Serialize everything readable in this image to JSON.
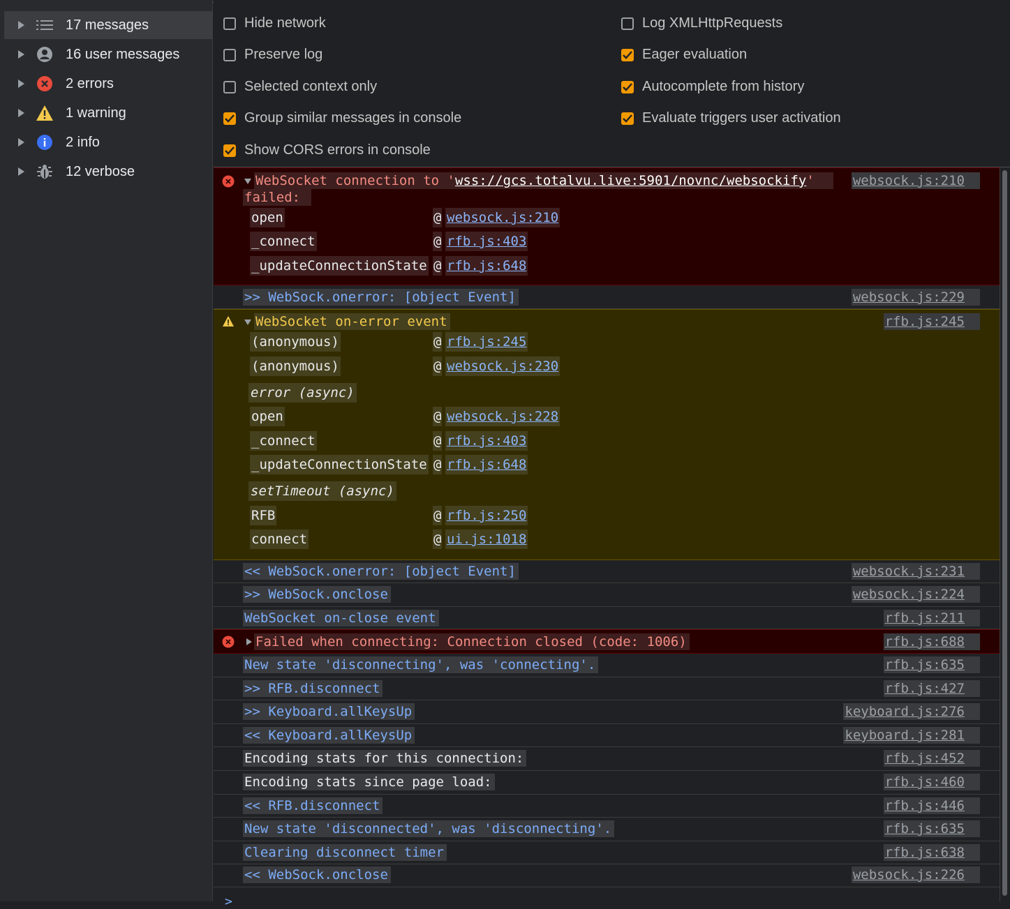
{
  "sidebar": {
    "items": [
      {
        "label": "17 messages",
        "icon": "list-icon"
      },
      {
        "label": "16 user messages",
        "icon": "user-icon"
      },
      {
        "label": "2 errors",
        "icon": "error-icon"
      },
      {
        "label": "1 warning",
        "icon": "warning-icon"
      },
      {
        "label": "2 info",
        "icon": "info-icon"
      },
      {
        "label": "12 verbose",
        "icon": "bug-icon"
      }
    ]
  },
  "settings": {
    "left": [
      {
        "label": "Hide network",
        "checked": false
      },
      {
        "label": "Preserve log",
        "checked": false
      },
      {
        "label": "Selected context only",
        "checked": false
      },
      {
        "label": "Group similar messages in console",
        "checked": true
      },
      {
        "label": "Show CORS errors in console",
        "checked": true
      }
    ],
    "right": [
      {
        "label": "Log XMLHttpRequests",
        "checked": false
      },
      {
        "label": "Eager evaluation",
        "checked": true
      },
      {
        "label": "Autocomplete from history",
        "checked": true
      },
      {
        "label": "Evaluate triggers user activation",
        "checked": true
      }
    ]
  },
  "colors": {
    "error_bg": "#290000",
    "warning_bg": "#332b00",
    "checkbox_on": "#f29900",
    "link": "#8ab4f8"
  },
  "console": {
    "error1": {
      "prefix": "WebSocket connection to '",
      "url": "wss://gcs.totalvu.live:5901/novnc/websockify",
      "suffix": "'",
      "line2": "failed: ",
      "source": "websock.js:210",
      "frames": [
        {
          "name": "open",
          "link": "websock.js:210"
        },
        {
          "name": "_connect",
          "link": "rfb.js:403"
        },
        {
          "name": "_updateConnectionState",
          "link": "rfb.js:648"
        }
      ]
    },
    "msg_onerror_in": {
      "text": ">> WebSock.onerror: [object Event]",
      "source": "websock.js:229"
    },
    "warning1": {
      "text": "WebSocket on-error event",
      "source": "rfb.js:245",
      "frames1": [
        {
          "name": "(anonymous)",
          "link": "rfb.js:245"
        },
        {
          "name": "(anonymous)",
          "link": "websock.js:230"
        }
      ],
      "async1": "error (async)",
      "frames2": [
        {
          "name": "open",
          "link": "websock.js:228"
        },
        {
          "name": "_connect",
          "link": "rfb.js:403"
        },
        {
          "name": "_updateConnectionState",
          "link": "rfb.js:648"
        }
      ],
      "async2": "setTimeout (async)",
      "frames3": [
        {
          "name": "RFB",
          "link": "rfb.js:250"
        },
        {
          "name": "connect",
          "link": "ui.js:1018"
        }
      ]
    },
    "rows": [
      {
        "text": "<< WebSock.onerror: [object Event]",
        "source": "websock.js:231",
        "color": "blue"
      },
      {
        "text": ">> WebSock.onclose",
        "source": "websock.js:224",
        "color": "blue"
      },
      {
        "text": "WebSocket on-close event",
        "source": "rfb.js:211",
        "color": "blue"
      }
    ],
    "error2": {
      "text": "Failed when connecting: Connection closed (code: 1006)",
      "source": "rfb.js:688"
    },
    "rows2": [
      {
        "text": "New state 'disconnecting', was 'connecting'.",
        "source": "rfb.js:635",
        "color": "blue"
      },
      {
        "text": ">> RFB.disconnect",
        "source": "rfb.js:427",
        "color": "blue"
      },
      {
        "text": ">> Keyboard.allKeysUp",
        "source": "keyboard.js:276",
        "color": "blue"
      },
      {
        "text": "<< Keyboard.allKeysUp",
        "source": "keyboard.js:281",
        "color": "blue"
      },
      {
        "text": "Encoding stats for this connection:",
        "source": "rfb.js:452",
        "color": "white"
      },
      {
        "text": "Encoding stats since page load:",
        "source": "rfb.js:460",
        "color": "white"
      },
      {
        "text": "<< RFB.disconnect",
        "source": "rfb.js:446",
        "color": "blue"
      },
      {
        "text": "New state 'disconnected', was 'disconnecting'.",
        "source": "rfb.js:635",
        "color": "blue"
      },
      {
        "text": "Clearing disconnect timer",
        "source": "rfb.js:638",
        "color": "blue"
      },
      {
        "text": "<< WebSock.onclose",
        "source": "websock.js:226",
        "color": "blue"
      }
    ],
    "prompt": ">"
  }
}
